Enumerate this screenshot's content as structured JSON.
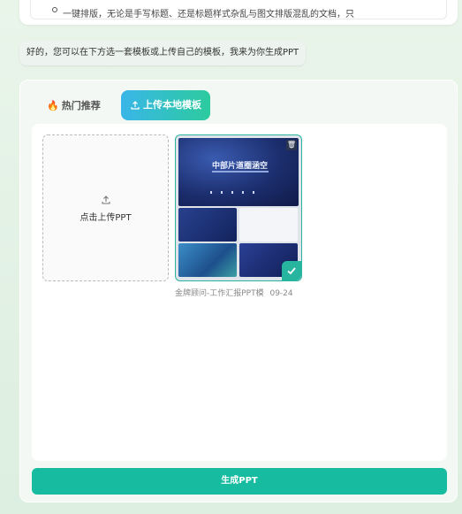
{
  "prev_message": {
    "text": "一键排版，无论是手写标题、还是标题样式杂乱与图文排版混乱的文档，只"
  },
  "assistant_reply": "好的，您可以在下方选一套模板或上传自己的模板，我来为你生成PPT",
  "tabs": [
    {
      "label": "热门推荐",
      "icon": "fire-icon",
      "active": false
    },
    {
      "label": "上传本地模板",
      "icon": "upload-icon",
      "active": true
    }
  ],
  "upload_box": {
    "label": "点击上传PPT",
    "icon": "upload-icon"
  },
  "template": {
    "slide_title": "中部片道圈涵空",
    "name": "金牌顾问-工作汇报PPT模",
    "date": "09-24",
    "selected": true
  },
  "generate_button": "生成PPT",
  "colors": {
    "accent": "#17bba0",
    "tab_gradient_start": "#39b6e8",
    "tab_gradient_end": "#2ccb9e"
  }
}
